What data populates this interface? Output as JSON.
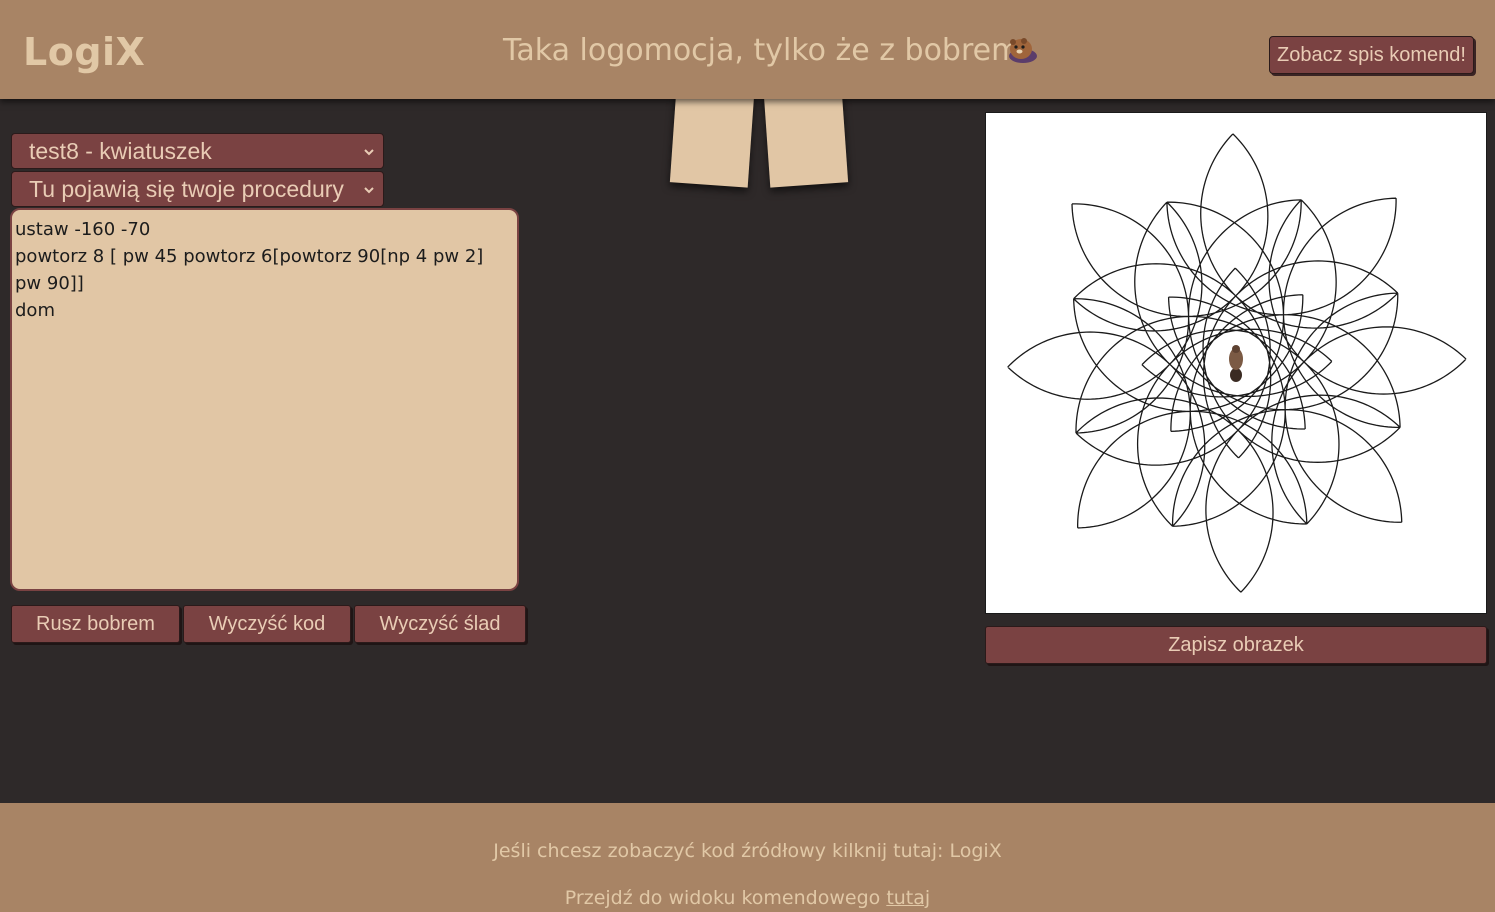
{
  "header": {
    "logo": "LogiX",
    "tagline": "Taka logomocja, tylko że z bobrem",
    "commands_button": "Zobacz spis komend!"
  },
  "editor": {
    "example_select": "test8 - kwiatuszek",
    "procedures_select": "Tu pojawią się twoje procedury",
    "code": "ustaw -160 -70\npowtorz 8 [ pw 45 powtorz 6[powtorz 90[np 4 pw 2] pw 90]]\ndom",
    "buttons": {
      "run": "Rusz bobrem",
      "clear_code": "Wyczyść kod",
      "clear_trail": "Wyczyść ślad"
    }
  },
  "canvas": {
    "save_button": "Zapisz obrazek"
  },
  "footer": {
    "source_text": "Jeśli chcesz zobaczyć kod źródłowy kilknij tutaj:",
    "source_link": "LogiX",
    "cmd_view_text": "Przejdź do widoku komendowego",
    "cmd_view_link": "tutaj"
  },
  "colors": {
    "header_bg": "#a88465",
    "page_bg": "#2e2929",
    "button_bg": "#7a4242",
    "button_text": "#e9ccb5",
    "textarea_bg": "#e1c6a5"
  },
  "icons": {
    "beaver": "beaver-icon",
    "select_chevron": "chevron-down-icon",
    "turtle": "beaver-turtle-icon"
  }
}
